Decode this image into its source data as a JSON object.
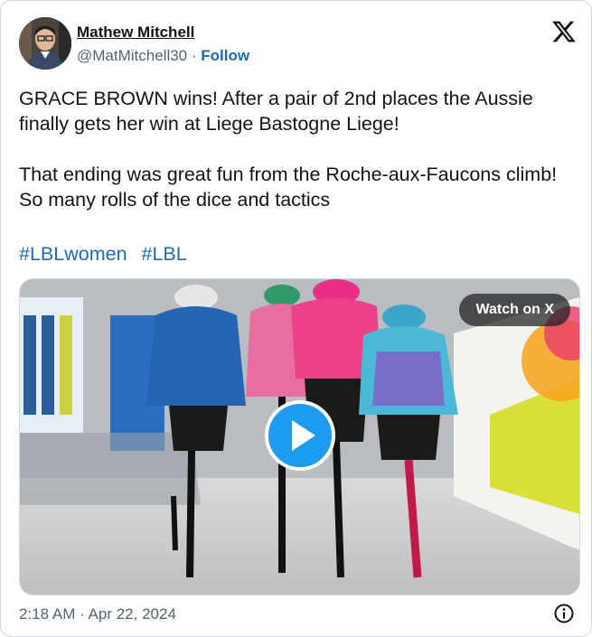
{
  "author": {
    "name": "Mathew Mitchell",
    "handle": "@MatMitchell30",
    "separator": "·",
    "follow_label": "Follow"
  },
  "tweet": {
    "line1": "GRACE BROWN wins! After a pair of 2nd places the Aussie finally gets her win at Liege Bastogne Liege!",
    "line2": "That ending was great fun from the Roche-aux-Faucons climb! So many rolls of the dice and tactics",
    "hashtags": [
      "#LBLwomen",
      "#LBL"
    ]
  },
  "media": {
    "watch_label": "Watch on X"
  },
  "footer": {
    "timestamp": "2:18 AM · Apr 22, 2024"
  },
  "icons": {
    "platform": "x-logo-icon",
    "play": "play-icon",
    "info": "info-icon"
  },
  "colors": {
    "link": "#1d6ab8",
    "play_button": "#1d9bf0",
    "secondary_text": "#536471"
  }
}
